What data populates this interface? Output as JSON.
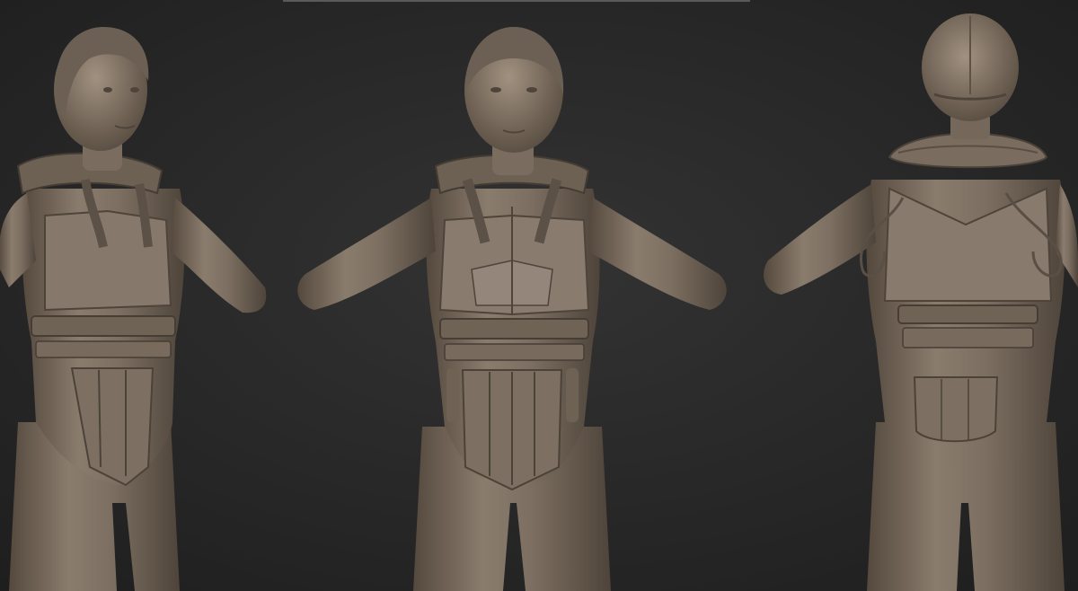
{
  "scene": {
    "background_color": "#2b2b2b",
    "material_color": "#7f7263",
    "material_shadow": "#4d443a",
    "material_highlight": "#a69686",
    "top_strip_color": "#5a5a5a"
  },
  "views": [
    {
      "name": "front-three-quarter-view"
    },
    {
      "name": "front-view"
    },
    {
      "name": "back-view"
    }
  ]
}
